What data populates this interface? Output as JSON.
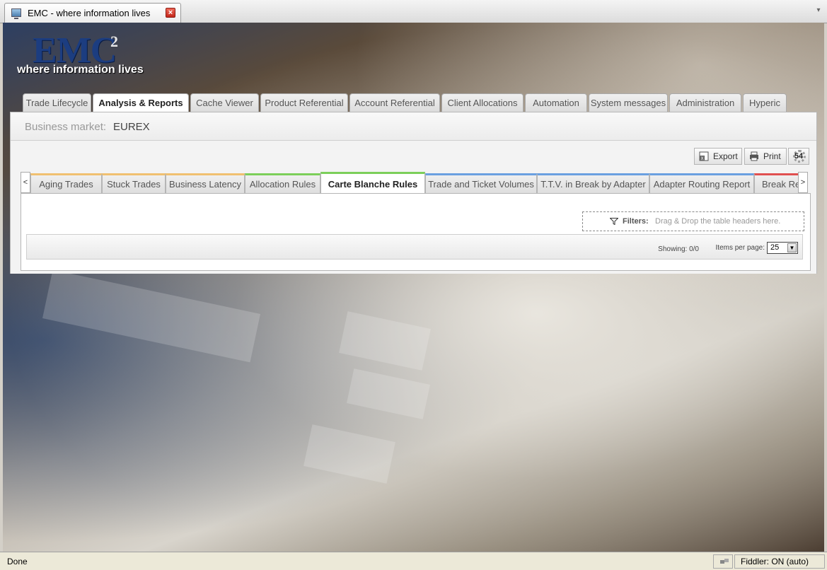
{
  "browser": {
    "tab_title": "EMC - where information lives"
  },
  "logo": {
    "main": "EMC",
    "superscript": "2",
    "tagline": "where information lives"
  },
  "main_tabs": [
    {
      "label": "Trade Lifecycle",
      "active": false
    },
    {
      "label": "Analysis & Reports",
      "active": true
    },
    {
      "label": "Cache Viewer",
      "active": false
    },
    {
      "label": "Product Referential",
      "active": false
    },
    {
      "label": "Account Referential",
      "active": false
    },
    {
      "label": "Client Allocations",
      "active": false
    },
    {
      "label": "Automation",
      "active": false
    },
    {
      "label": "System messages",
      "active": false
    },
    {
      "label": "Administration",
      "active": false
    },
    {
      "label": "Hyperic",
      "active": false
    }
  ],
  "market": {
    "label": "Business market:",
    "value": "EUREX"
  },
  "toolbar": {
    "export_label": "Export",
    "print_label": "Print",
    "badge_count": "54"
  },
  "sub_tabs": {
    "scroll_left": "<",
    "scroll_right": ">",
    "items": [
      {
        "label": "Aging Trades",
        "accent": "#f0c070",
        "active": false
      },
      {
        "label": "Stuck Trades",
        "accent": "#f0c070",
        "active": false
      },
      {
        "label": "Business Latency",
        "accent": "#f0c070",
        "active": false
      },
      {
        "label": "Allocation Rules",
        "accent": "#7ccf5a",
        "active": false
      },
      {
        "label": "Carte Blanche Rules",
        "accent": "#7ccf5a",
        "active": true
      },
      {
        "label": "Trade and Ticket Volumes",
        "accent": "#6aa0e0",
        "active": false
      },
      {
        "label": "T.T.V. in Break by Adapter",
        "accent": "#6aa0e0",
        "active": false
      },
      {
        "label": "Adapter Routing Report",
        "accent": "#6aa0e0",
        "active": false
      },
      {
        "label": "Break Repo",
        "accent": "#e05050",
        "active": false
      }
    ]
  },
  "filters": {
    "label": "Filters:",
    "hint": "Drag & Drop the table headers here."
  },
  "grid": {
    "showing": "Showing: 0/0",
    "items_per_page_label": "Items per page:",
    "items_per_page_value": "25"
  },
  "statusbar": {
    "status": "Done",
    "fiddler": "Fiddler: ON (auto)"
  }
}
